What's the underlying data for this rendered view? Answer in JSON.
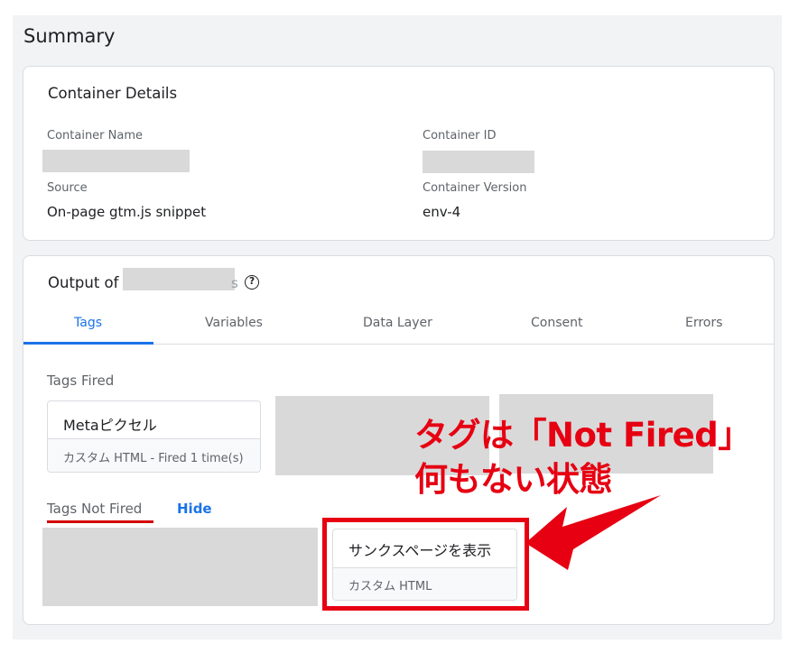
{
  "page": {
    "title": "Summary"
  },
  "container_details": {
    "title": "Container Details",
    "name_label": "Container Name",
    "id_label": "Container ID",
    "source_label": "Source",
    "source_value": "On-page gtm.js snippet",
    "version_label": "Container Version",
    "version_value": "env-4"
  },
  "output": {
    "title_prefix": "Output of",
    "trailing_fragment": "s",
    "help_icon": "?",
    "tabs": [
      {
        "label": "Tags",
        "active": true
      },
      {
        "label": "Variables",
        "active": false
      },
      {
        "label": "Data Layer",
        "active": false
      },
      {
        "label": "Consent",
        "active": false
      },
      {
        "label": "Errors",
        "active": false
      }
    ],
    "tags_fired": {
      "label": "Tags Fired",
      "items": [
        {
          "name": "Metaピクセル",
          "meta": "カスタム HTML - Fired 1 time(s)"
        }
      ]
    },
    "tags_not_fired": {
      "label": "Tags Not Fired",
      "hide_label": "Hide",
      "items": [
        {
          "name": "サンクスページを表示",
          "meta": "カスタム HTML"
        }
      ]
    }
  },
  "annotation": {
    "line1": "タグは「Not Fired」",
    "line2": "何もない状態",
    "color": "#e60012"
  },
  "colors": {
    "accent": "#1a73e8",
    "highlight": "#e60012"
  }
}
